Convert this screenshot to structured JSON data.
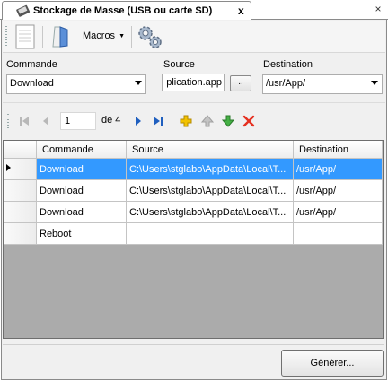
{
  "tab": {
    "title": "Stockage de Masse (USB ou carte SD)",
    "close": "x"
  },
  "strip_close": "×",
  "toolbar": {
    "macros_label": "Macros",
    "macros_arrow": "▼"
  },
  "fields": {
    "commande_label": "Commande",
    "commande_value": "Download",
    "source_label": "Source",
    "source_value": "plication.app",
    "browse_label": "..",
    "destination_label": "Destination",
    "destination_value": "/usr/App/"
  },
  "navigation": {
    "current_page": "1",
    "page_of": "de 4"
  },
  "grid": {
    "columns": [
      "Commande",
      "Source",
      "Destination"
    ],
    "rows": [
      {
        "commande": "Download",
        "source": "C:\\Users\\stglabo\\AppData\\Local\\T...",
        "destination": "/usr/App/",
        "selected": true
      },
      {
        "commande": "Download",
        "source": "C:\\Users\\stglabo\\AppData\\Local\\T...",
        "destination": "/usr/App/",
        "selected": false
      },
      {
        "commande": "Download",
        "source": "C:\\Users\\stglabo\\AppData\\Local\\T...",
        "destination": "/usr/App/",
        "selected": false
      },
      {
        "commande": "Reboot",
        "source": "",
        "destination": "",
        "selected": false
      }
    ]
  },
  "footer": {
    "generate_label": "Générer..."
  },
  "colors": {
    "selection": "#3399ff",
    "add": "#e8a800",
    "up": "#b0b0b0",
    "down": "#3aa03a",
    "delete": "#e53020"
  }
}
